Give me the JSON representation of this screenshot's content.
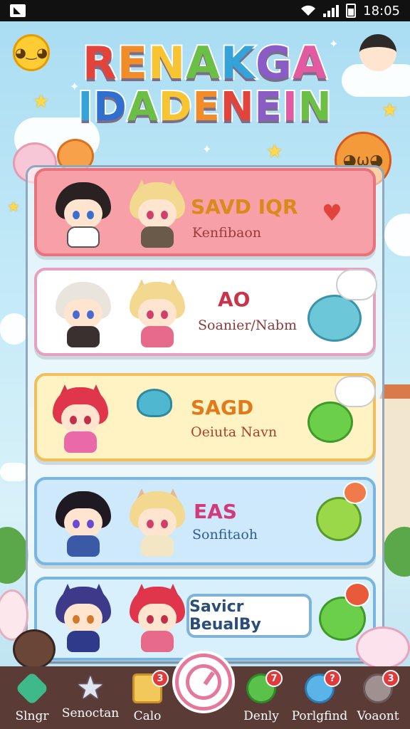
{
  "status_bar": {
    "time": "18:05"
  },
  "title": {
    "line1": "RENAKGA",
    "line2": "IDADENEIN",
    "line1_colors": [
      "#e2443c",
      "#f08c2a",
      "#f6c531",
      "#6cbf45",
      "#34a3d8",
      "#8a5cc6",
      "#e25aa0"
    ],
    "line2_colors": [
      "#34a3d8",
      "#2f6fd0",
      "#6cbf45",
      "#f6c531",
      "#f08c2a",
      "#e2443c",
      "#8a5cc6",
      "#e25aa0",
      "#6cbf45"
    ]
  },
  "cards": [
    {
      "title": "SAVD IQR",
      "subtitle": "Kenfibaon",
      "bg": "#f7a0a8",
      "border": "#e8737e",
      "title_color": "#d98a1a",
      "sub_color": "#9c3a3a",
      "accent_icon": "heart-icon"
    },
    {
      "title": "AO",
      "subtitle": "Soanier/Nabm",
      "bg": "#ffffff",
      "border": "#e8a0c0",
      "title_color": "#c8344a",
      "sub_color": "#8a3a3a",
      "accent_icon": "blue-blob-icon"
    },
    {
      "title": "SAGD",
      "subtitle": "Oeiuta Navn",
      "bg": "#fff3c4",
      "border": "#f0bf5c",
      "title_color": "#e07a1a",
      "sub_color": "#b0402a",
      "accent_icon": "green-blob-icon"
    },
    {
      "title": "EAS",
      "subtitle": "Sonfitaoh",
      "bg": "#cde9fb",
      "border": "#79b5e3",
      "title_color": "#d23a7a",
      "sub_color": "#2f5e94",
      "accent_icon": "green-spiky-icon"
    },
    {
      "title": "",
      "subtitle": "",
      "bg": "#d7f0fb",
      "border": "#79b5e3",
      "button_label": "Savicr BeualBy",
      "accent_icon": "green-spiky-icon"
    }
  ],
  "nav": {
    "items": [
      {
        "label": "Slngr",
        "icon": "gem-icon",
        "badge": ""
      },
      {
        "label": "Senoctan",
        "icon": "star-icon",
        "badge": ""
      },
      {
        "label": "Calo",
        "icon": "bag-icon",
        "badge": "3"
      },
      {
        "label": "Denly",
        "icon": "chat-icon",
        "badge": "7"
      },
      {
        "label": "Porlgfind",
        "icon": "potion-icon",
        "badge": "?"
      },
      {
        "label": "Voaont",
        "icon": "pet-icon",
        "badge": "3"
      }
    ]
  }
}
